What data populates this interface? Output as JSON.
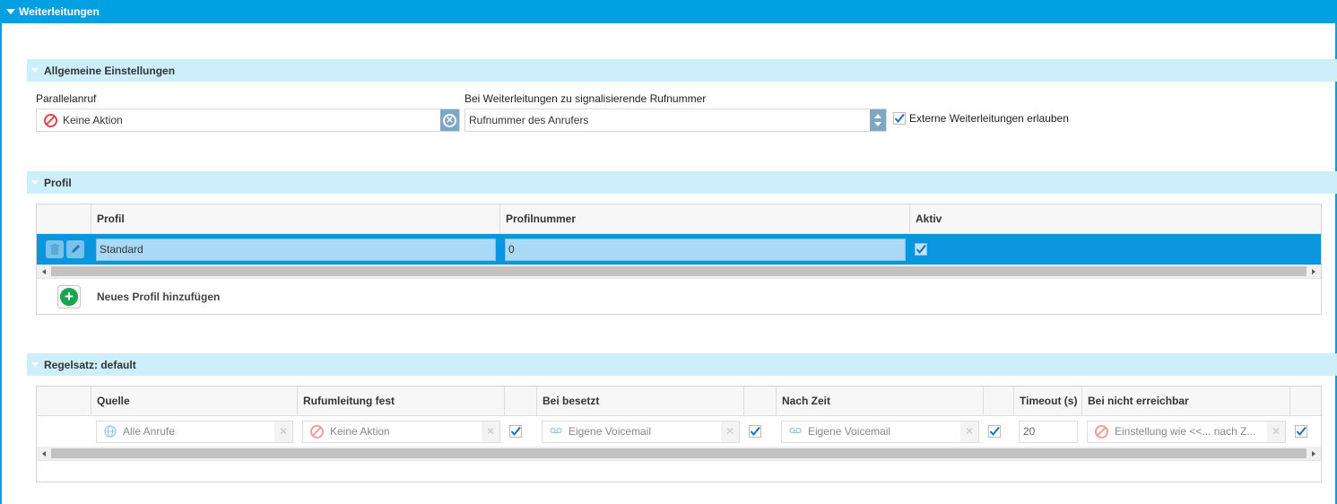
{
  "header": {
    "title": "Weiterleitungen"
  },
  "general": {
    "title": "Allgemeine Einstellungen",
    "parallel_label": "Parallelanruf",
    "parallel_value": "Keine Aktion",
    "signal_label": "Bei Weiterleitungen zu signalisierende Rufnummer",
    "signal_value": "Rufnummer des Anrufers",
    "external_label": "Externe Weiterleitungen erlauben",
    "external_checked": true
  },
  "profile": {
    "title": "Profil",
    "columns": [
      "Profil",
      "Profilnummer",
      "Aktiv"
    ],
    "rows": [
      {
        "name": "Standard",
        "number": "0",
        "active": true
      }
    ],
    "add_label": "Neues Profil hinzufügen"
  },
  "ruleset": {
    "title": "Regelsatz: default",
    "columns": [
      "Quelle",
      "Rufumleitung fest",
      "Bei besetzt",
      "Nach Zeit",
      "Timeout (s)",
      "Bei nicht erreichbar"
    ],
    "row": {
      "source": "Alle Anrufe",
      "fixed": "Keine Aktion",
      "busy": "Eigene Voicemail",
      "after_time": "Eigene Voicemail",
      "timeout": "20",
      "unreachable": "Einstellung wie <<... nach Z..."
    }
  },
  "colors": {
    "accent": "#00a0e3",
    "section_bg": "#cdeefb",
    "selected_row": "#0a95de"
  }
}
